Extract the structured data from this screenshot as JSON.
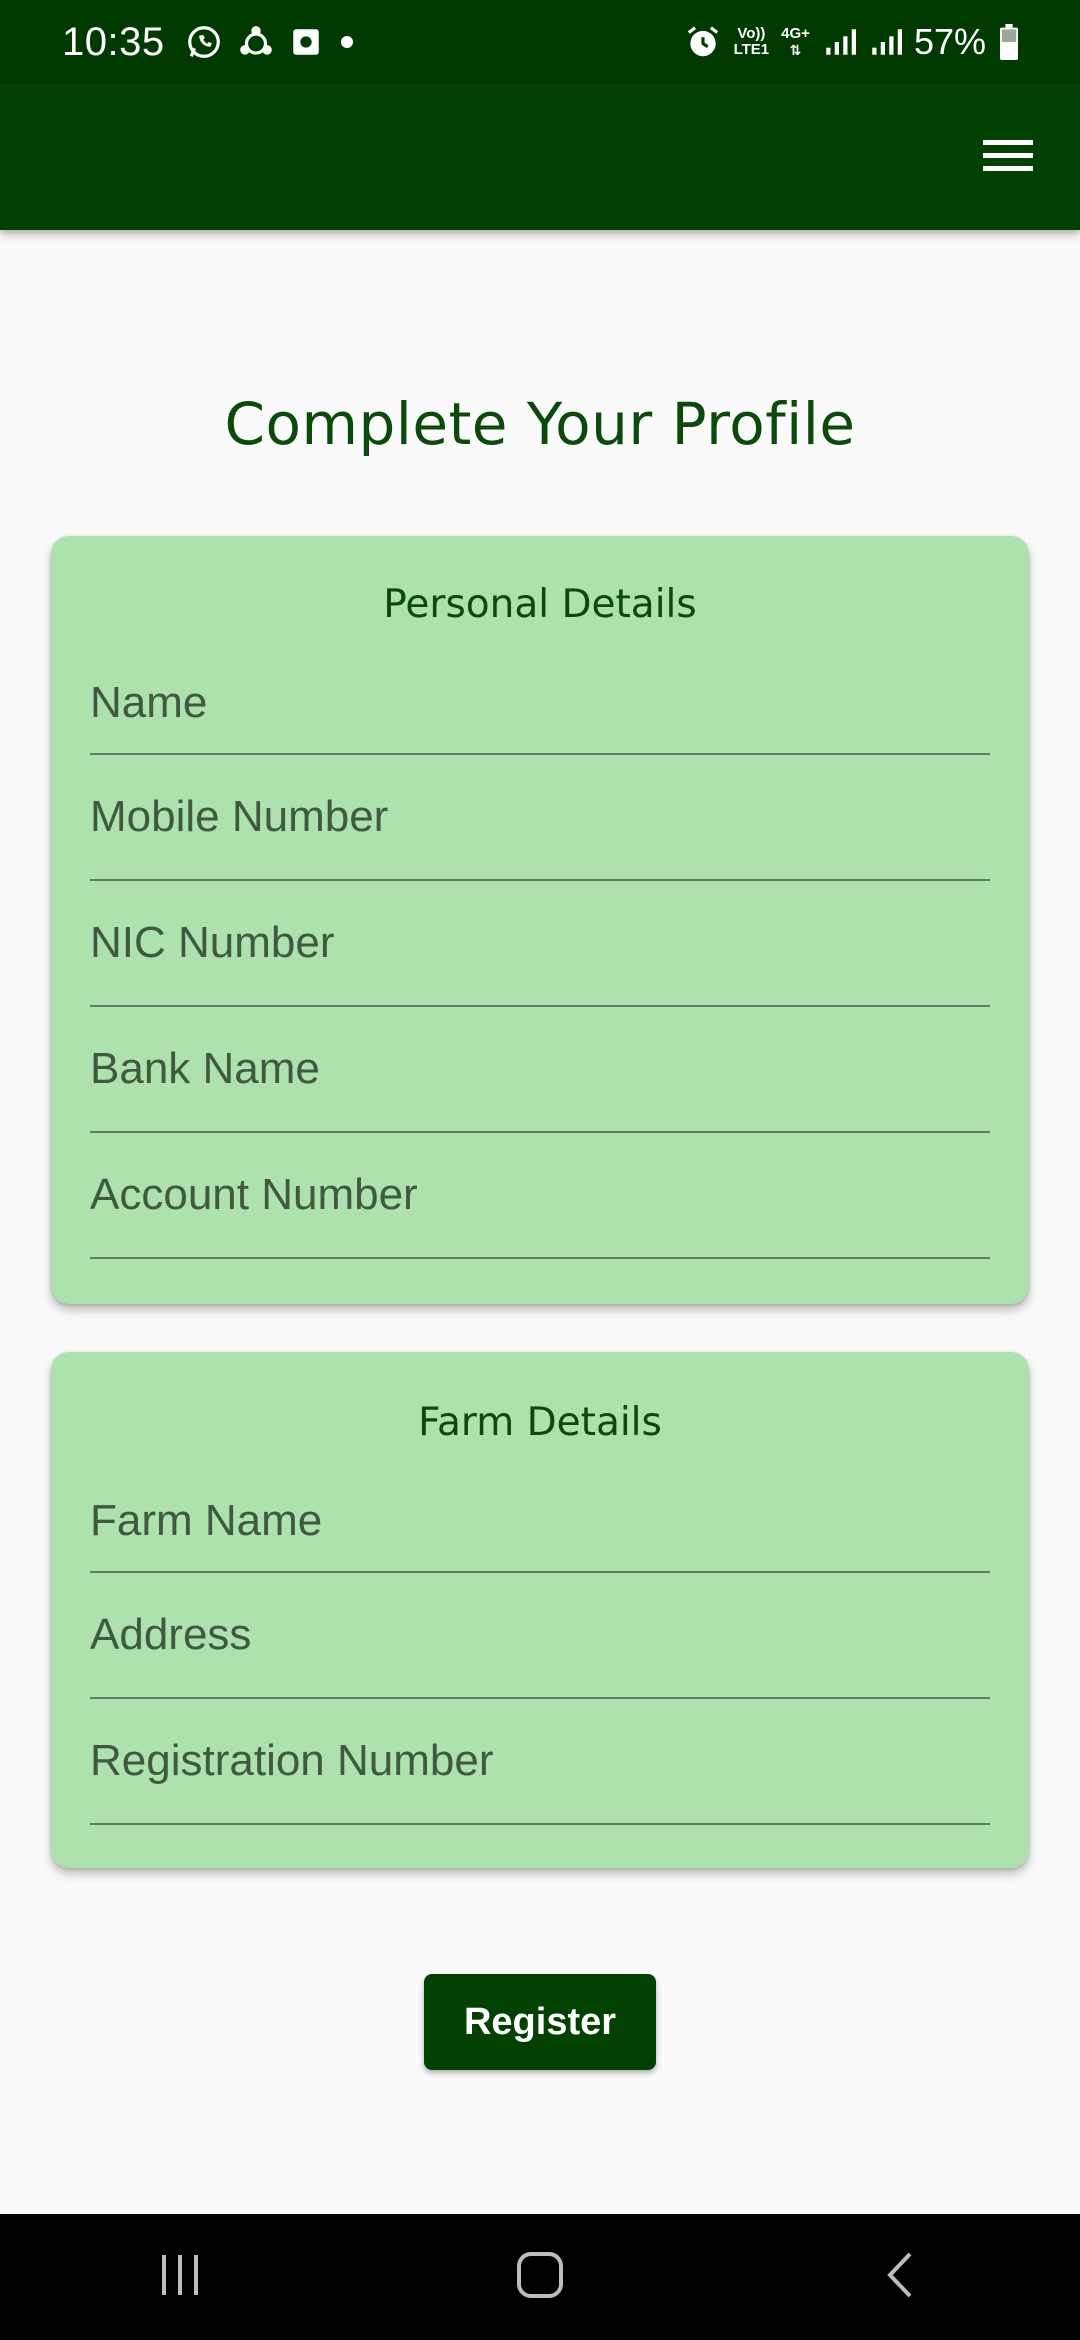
{
  "status_bar": {
    "time": "10:35",
    "battery_percent": "57%",
    "network_label_top": "Vo))",
    "network_label_bottom": "LTE1",
    "network_type": "4G+",
    "icons_left": [
      "whatsapp-icon",
      "sync-icon",
      "photo-icon",
      "dot-icon"
    ],
    "icons_right": [
      "alarm-icon",
      "volte-icon",
      "4g-icon",
      "signal-icon",
      "signal-icon",
      "battery-icon"
    ]
  },
  "app_bar": {
    "menu_icon": "hamburger-menu-icon",
    "background_color": "#024102"
  },
  "page": {
    "title": "Complete Your Profile",
    "title_color": "#0c4a0c",
    "card_color": "#ade1ad"
  },
  "personal_details": {
    "title": "Personal Details",
    "fields": {
      "name": "Name",
      "mobile_number": "Mobile Number",
      "nic_number": "NIC Number",
      "bank_name": "Bank Name",
      "account_number": "Account Number"
    }
  },
  "farm_details": {
    "title": "Farm Details",
    "fields": {
      "farm_name": "Farm Name",
      "address": "Address",
      "registration_number": "Registration Number"
    }
  },
  "actions": {
    "register_label": "Register"
  },
  "nav_bar": {
    "items": [
      "recent-apps-icon",
      "home-icon",
      "back-icon"
    ]
  }
}
